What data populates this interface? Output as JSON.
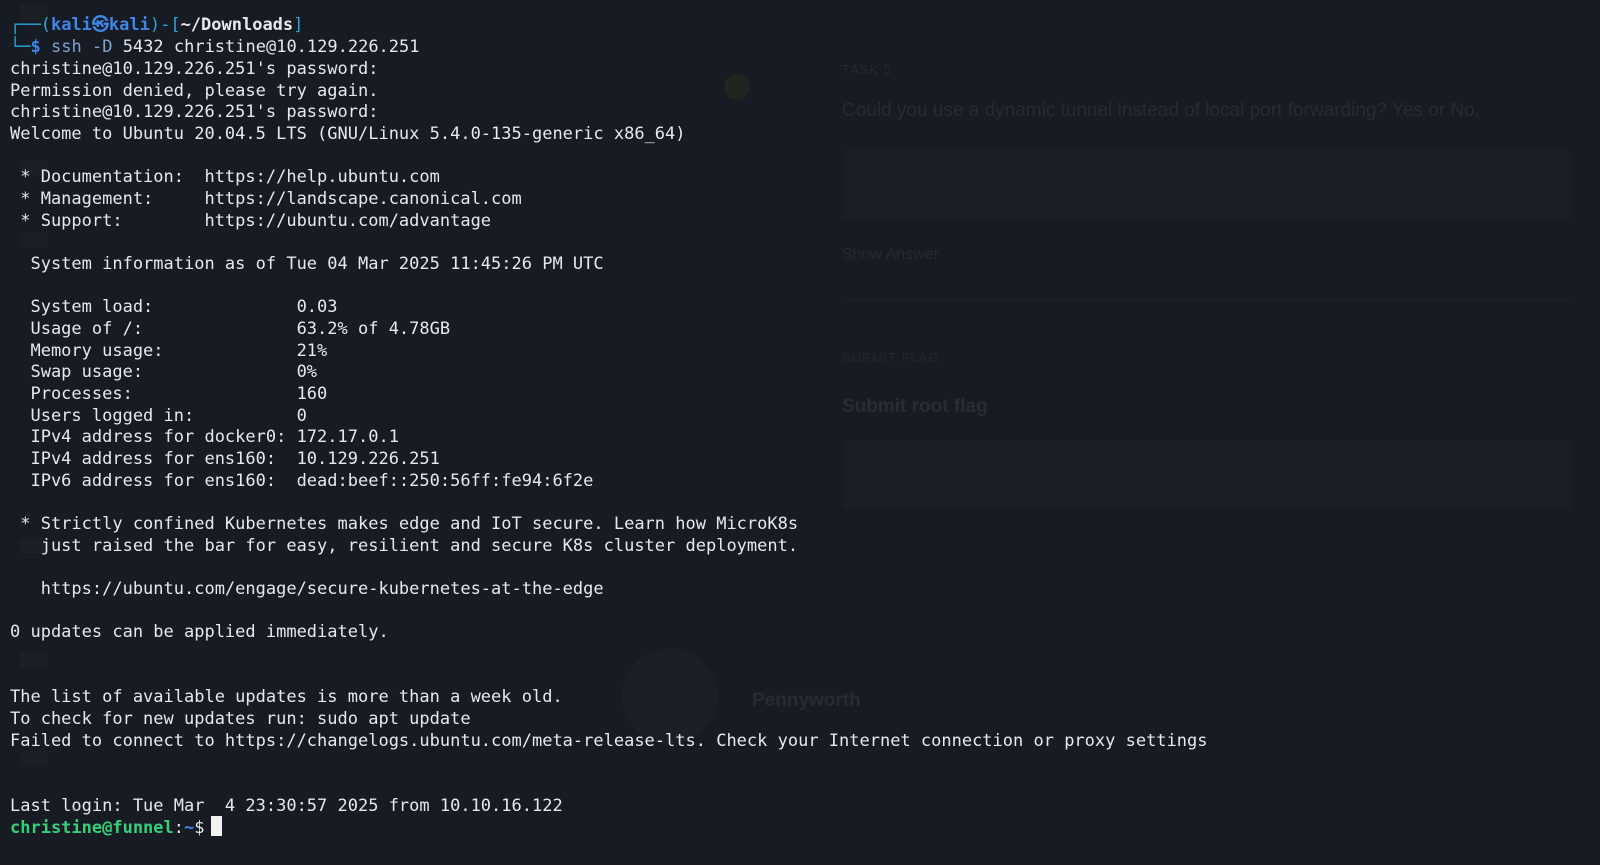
{
  "background_window": {
    "question_label": "TASK 5",
    "question": "Could you use a dynamic tunnel instead of local port forwarding? Yes or No.",
    "submit_label": "Show Answer",
    "task_label": "SUBMIT FLAG",
    "task_text": "Submit root flag",
    "author_name": "Pennyworth"
  },
  "terminal": {
    "prompt": {
      "open": "┌──(",
      "user_host": "kali㉿kali",
      "close_path_open": ")-[",
      "path": "~/Downloads",
      "close_path": "]",
      "second_line_prefix": "└─",
      "symbol": "$"
    },
    "command": {
      "program": "ssh",
      "flag": "-D",
      "args": "5432 christine@10.129.226.251"
    },
    "output": [
      "christine@10.129.226.251's password:",
      "Permission denied, please try again.",
      "christine@10.129.226.251's password:",
      "Welcome to Ubuntu 20.04.5 LTS (GNU/Linux 5.4.0-135-generic x86_64)",
      "",
      " * Documentation:  https://help.ubuntu.com",
      " * Management:     https://landscape.canonical.com",
      " * Support:        https://ubuntu.com/advantage",
      "",
      "  System information as of Tue 04 Mar 2025 11:45:26 PM UTC",
      "",
      "  System load:              0.03",
      "  Usage of /:               63.2% of 4.78GB",
      "  Memory usage:             21%",
      "  Swap usage:               0%",
      "  Processes:                160",
      "  Users logged in:          0",
      "  IPv4 address for docker0: 172.17.0.1",
      "  IPv4 address for ens160:  10.129.226.251",
      "  IPv6 address for ens160:  dead:beef::250:56ff:fe94:6f2e",
      "",
      " * Strictly confined Kubernetes makes edge and IoT secure. Learn how MicroK8s",
      "   just raised the bar for easy, resilient and secure K8s cluster deployment.",
      "",
      "   https://ubuntu.com/engage/secure-kubernetes-at-the-edge",
      "",
      "0 updates can be applied immediately.",
      "",
      "",
      "The list of available updates is more than a week old.",
      "To check for new updates run: sudo apt update",
      "Failed to connect to https://changelogs.ubuntu.com/meta-release-lts. Check your Internet connection or proxy settings",
      "",
      "",
      "Last login: Tue Mar  4 23:30:57 2025 from 10.10.16.122"
    ],
    "remote_prompt": {
      "user_host": "christine@funnel",
      "separator": ":",
      "path": "~",
      "symbol": "$"
    }
  }
}
